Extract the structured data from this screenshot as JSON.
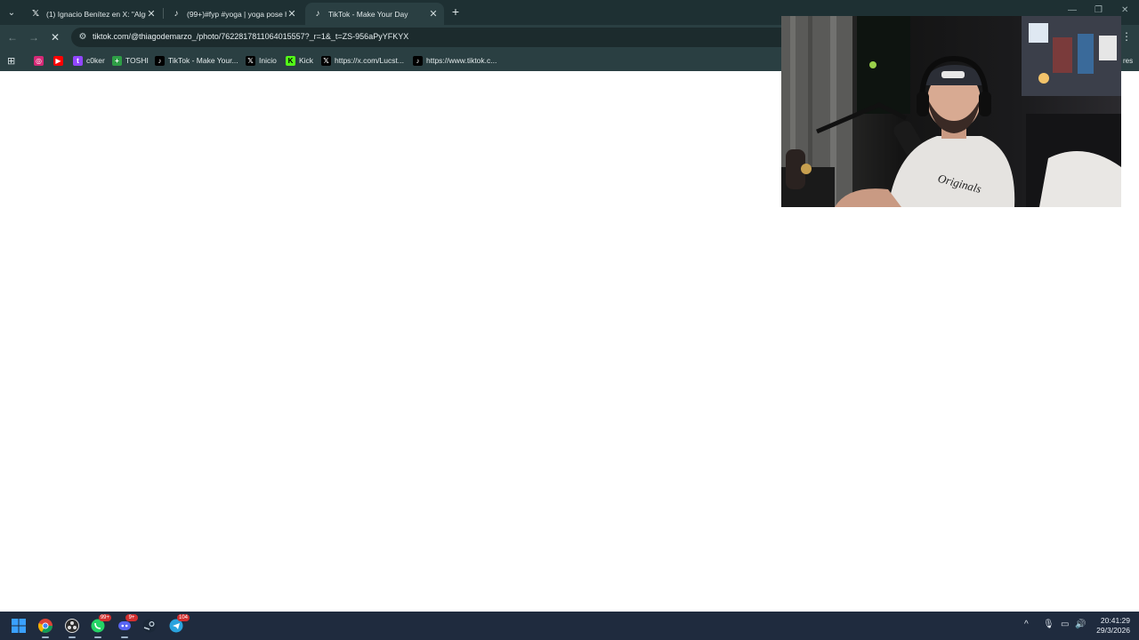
{
  "browser": {
    "tabs": [
      {
        "title": "(1) Ignacio Benítez en X: \"Algun",
        "favicon": "x-logo-icon",
        "active": false
      },
      {
        "title": "(99+)#fyp #yoga | yoga pose h",
        "favicon": "tiktok-icon",
        "active": false
      },
      {
        "title": "TikTok - Make Your Day",
        "favicon": "tiktok-icon",
        "active": true
      }
    ],
    "new_tab_label": "+",
    "url": "tiktok.com/@thiagodemarzo_/photo/7622817811064015557?_r=1&_t=ZS-956aPyYFKYX",
    "bookmarks": [
      {
        "label": "",
        "icon": "instagram-icon",
        "color": "#d62976"
      },
      {
        "label": "",
        "icon": "youtube-icon",
        "color": "#ff0000"
      },
      {
        "label": "c0ker",
        "icon": "twitch-icon",
        "color": "#9146ff"
      },
      {
        "label": "TOSHI",
        "icon": "plus-icon",
        "color": "#2e9e46"
      },
      {
        "label": "TikTok - Make Your...",
        "icon": "tiktok-icon",
        "color": "#000000"
      },
      {
        "label": "Inicio",
        "icon": "x-logo-icon",
        "color": "#000000"
      },
      {
        "label": "Kick",
        "icon": "kick-icon",
        "color": "#53fc18"
      },
      {
        "label": "https://x.com/Lucst...",
        "icon": "x-logo-icon",
        "color": "#000000"
      },
      {
        "label": "https://www.tiktok.c...",
        "icon": "tiktok-icon",
        "color": "#000000"
      }
    ],
    "bookmarks_more": "res"
  },
  "taskbar": {
    "apps": [
      {
        "name": "windows-start-icon",
        "badge": ""
      },
      {
        "name": "chrome-icon",
        "badge": ""
      },
      {
        "name": "obs-icon",
        "badge": ""
      },
      {
        "name": "whatsapp-icon",
        "badge": "99+"
      },
      {
        "name": "discord-icon",
        "badge": "9+"
      },
      {
        "name": "steam-icon",
        "badge": ""
      },
      {
        "name": "telegram-icon",
        "badge": "104"
      }
    ],
    "time": "20:41:29",
    "date": "29/3/2026"
  },
  "colors": {
    "tabstrip": "#1e3033",
    "toolbar": "#2a3f42",
    "taskbar": "#1f2b3e"
  }
}
